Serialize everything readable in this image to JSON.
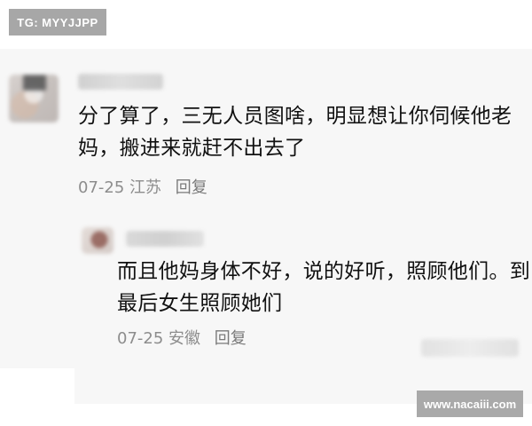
{
  "top_tag": {
    "text": "TG: MYYJJPP"
  },
  "comments": [
    {
      "text": "分了算了，三无人员图啥，明显想让你伺候他老妈，搬进来就赶不出去了",
      "date": "07-25",
      "location": "江苏",
      "reply_label": "回复"
    },
    {
      "text": "而且他妈身体不好，说的好听，照顾他们。到最后女生照顾她们",
      "date": "07-25",
      "location": "安徽",
      "reply_label": "回复"
    }
  ],
  "watermark": {
    "text": "www.nacaiii.com"
  }
}
